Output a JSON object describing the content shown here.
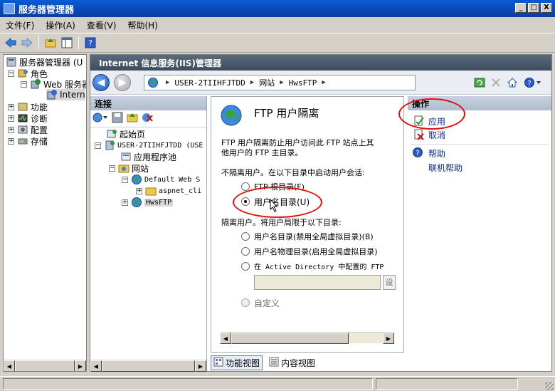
{
  "window": {
    "title": "服务器管理器",
    "btn_min": "_",
    "btn_max": "□",
    "btn_close": "X"
  },
  "menu": [
    {
      "label": "文件(F)"
    },
    {
      "label": "操作(A)"
    },
    {
      "label": "查看(V)"
    },
    {
      "label": "帮助(H)"
    }
  ],
  "left_tree": {
    "items": [
      {
        "label": "服务器管理器 (U",
        "expander": ""
      },
      {
        "label": "角色",
        "expander": "−"
      },
      {
        "label": "Web 服务器",
        "expander": "−"
      },
      {
        "label": "Intern",
        "expander": ""
      },
      {
        "label": "功能",
        "expander": "+"
      },
      {
        "label": "诊断",
        "expander": "+"
      },
      {
        "label": "配置",
        "expander": "+"
      },
      {
        "label": "存储",
        "expander": "+"
      }
    ]
  },
  "iis": {
    "title": "Internet 信息服务(IIS)管理器",
    "breadcrumb": [
      "USER-2TIIHFJTDD",
      "网站",
      "HwsFTP"
    ]
  },
  "connections": {
    "header": "连接",
    "tree": [
      {
        "label": "起始页",
        "expander": ""
      },
      {
        "label": "USER-2TIIHFJTDD (USE",
        "expander": "−"
      },
      {
        "label": "应用程序池",
        "expander": ""
      },
      {
        "label": "网站",
        "expander": "−"
      },
      {
        "label": "Default Web S",
        "expander": "−"
      },
      {
        "label": "aspnet_cli",
        "expander": "+"
      },
      {
        "label": "HwsFTP",
        "expander": "+"
      }
    ]
  },
  "content": {
    "title": "FTP 用户隔离",
    "description_line1": "FTP 用户隔离防止用户访问此 FTP 站点上其",
    "description_line2": "他用户的 FTP 主目录。",
    "no_isolate_label": "不隔离用户。在以下目录中启动用户会话:",
    "opt_ftp_root": "FTP 根目录(F)",
    "opt_user_dir": "用户名目录(U)",
    "isolate_label": "隔离用户。将用户局限于以下目录:",
    "opt_user_dir_disable_global": "用户名目录(禁用全局虚拟目录)(B)",
    "opt_user_physical_dir": "用户名物理目录(启用全局虚拟目录)",
    "opt_ad": "在 Active Directory 中配置的 FTP",
    "ad_button": "设",
    "opt_custom": "自定义",
    "selected_option": "opt_user_dir"
  },
  "actions": {
    "header": "操作",
    "apply": "应用",
    "cancel": "取消",
    "help": "帮助",
    "online_help": "联机帮助"
  },
  "bottom_tabs": {
    "feature_view": "功能视图",
    "content_view": "内容视图"
  },
  "colors": {
    "titlebar": "#0b48b8",
    "iis_titlebar": "#3c4b5c",
    "link": "#0a2b8c",
    "annotation": "#e01010"
  }
}
